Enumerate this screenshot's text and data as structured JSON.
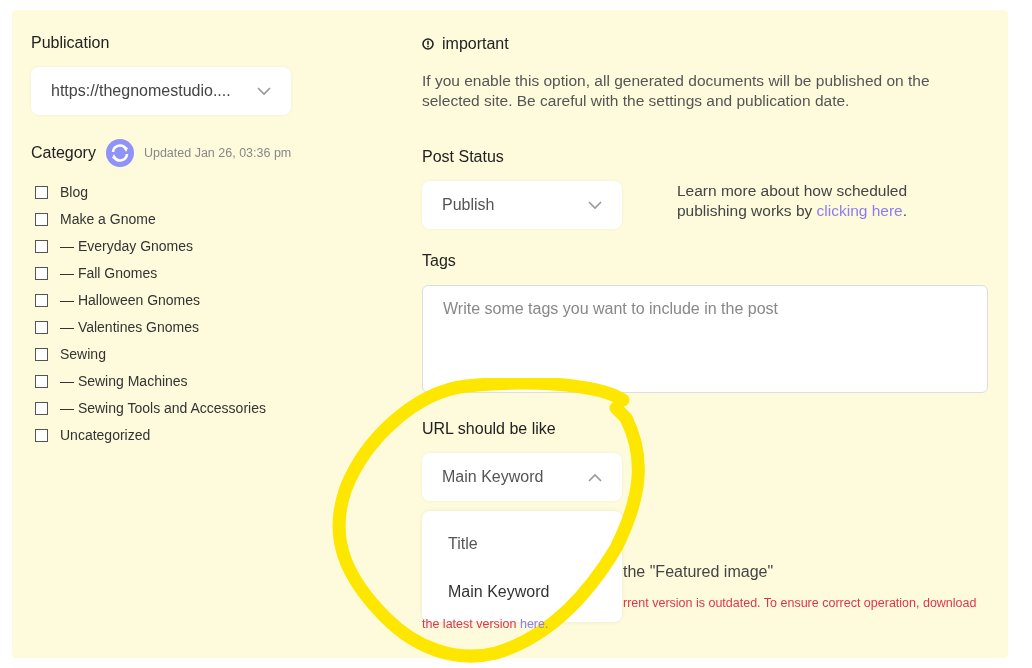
{
  "publication": {
    "label": "Publication",
    "value": "https://thegnomestudio....",
    "expanded": false
  },
  "category": {
    "label": "Category",
    "updated": "Updated Jan 26, 03:36 pm",
    "items": [
      {
        "label": "Blog",
        "checked": false
      },
      {
        "label": "Make a Gnome",
        "checked": false,
        "children": [
          {
            "label": "— Everyday Gnomes",
            "checked": false
          },
          {
            "label": "— Fall Gnomes",
            "checked": false
          },
          {
            "label": "— Halloween Gnomes",
            "checked": false
          },
          {
            "label": "— Valentines Gnomes",
            "checked": false
          }
        ]
      },
      {
        "label": "Sewing",
        "checked": false,
        "children": [
          {
            "label": "— Sewing Machines",
            "checked": false
          },
          {
            "label": "— Sewing Tools and Accessories",
            "checked": false
          }
        ]
      },
      {
        "label": "Uncategorized",
        "checked": false
      }
    ]
  },
  "important": {
    "title": "important",
    "text": "If you enable this option, all generated documents will be published on the selected site. Be careful with the settings and publication date."
  },
  "post_status": {
    "label": "Post Status",
    "value": "Publish",
    "expanded": false,
    "help": "Learn more about how scheduled publishing works by ",
    "help_link": "clicking here",
    "help_end": "."
  },
  "tags": {
    "label": "Tags",
    "placeholder": "Write some tags you want to include in the post"
  },
  "url_format": {
    "label": "URL should be like",
    "value": "Main Keyword",
    "expanded": true,
    "options": [
      {
        "label": "Title",
        "selected": false
      },
      {
        "label": "Main Keyword",
        "selected": true
      }
    ]
  },
  "featured_image": {
    "text": "the \"Featured image\""
  },
  "warning": {
    "line_1": "rrent version is outdated. To ensure correct operation, download",
    "line_2": "the latest version ",
    "link": "here."
  }
}
